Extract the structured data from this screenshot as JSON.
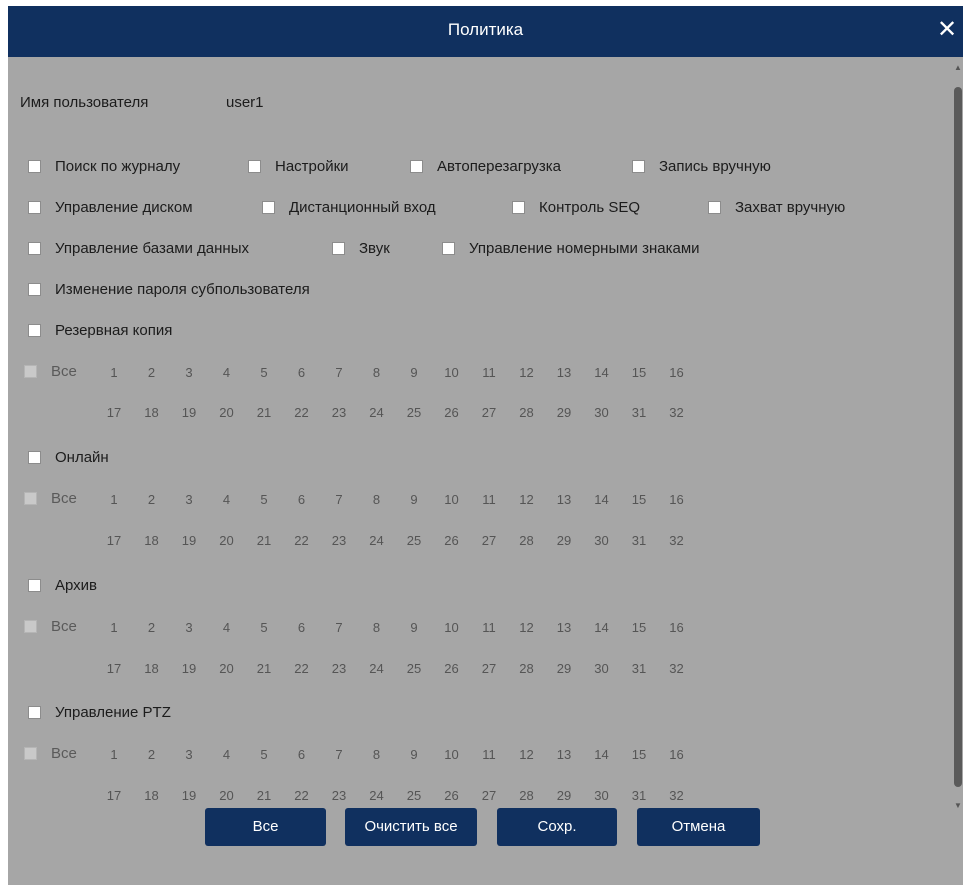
{
  "dialog": {
    "title": "Политика",
    "close_icon": "close-icon"
  },
  "user": {
    "label": "Имя пользователя",
    "value": "user1"
  },
  "permissions": {
    "row1": [
      "Поиск по журналу",
      "Настройки",
      "Автоперезагрузка",
      "Запись вручную"
    ],
    "row2": [
      "Управление диском",
      "Дистанционный вход",
      "Контроль SEQ",
      "Захват вручную"
    ],
    "row3": [
      "Управление базами данных",
      "Звук",
      "Управление номерными знаками"
    ],
    "row4": [
      "Изменение пароля субпользователя"
    ]
  },
  "channel_sections": [
    {
      "label": "Резервная копия"
    },
    {
      "label": "Онлайн"
    },
    {
      "label": "Архив"
    },
    {
      "label": "Управление PTZ"
    }
  ],
  "channels": {
    "all_label": "Все",
    "row1": [
      "1",
      "2",
      "3",
      "4",
      "5",
      "6",
      "7",
      "8",
      "9",
      "10",
      "11",
      "12",
      "13",
      "14",
      "15",
      "16"
    ],
    "row2": [
      "17",
      "18",
      "19",
      "20",
      "21",
      "22",
      "23",
      "24",
      "25",
      "26",
      "27",
      "28",
      "29",
      "30",
      "31",
      "32"
    ]
  },
  "buttons": {
    "all": "Все",
    "clear_all": "Очистить все",
    "save": "Сохр.",
    "cancel": "Отмена"
  },
  "colors": {
    "titlebar": "#10305f",
    "body": "#a6a6a6",
    "button": "#10305f"
  }
}
